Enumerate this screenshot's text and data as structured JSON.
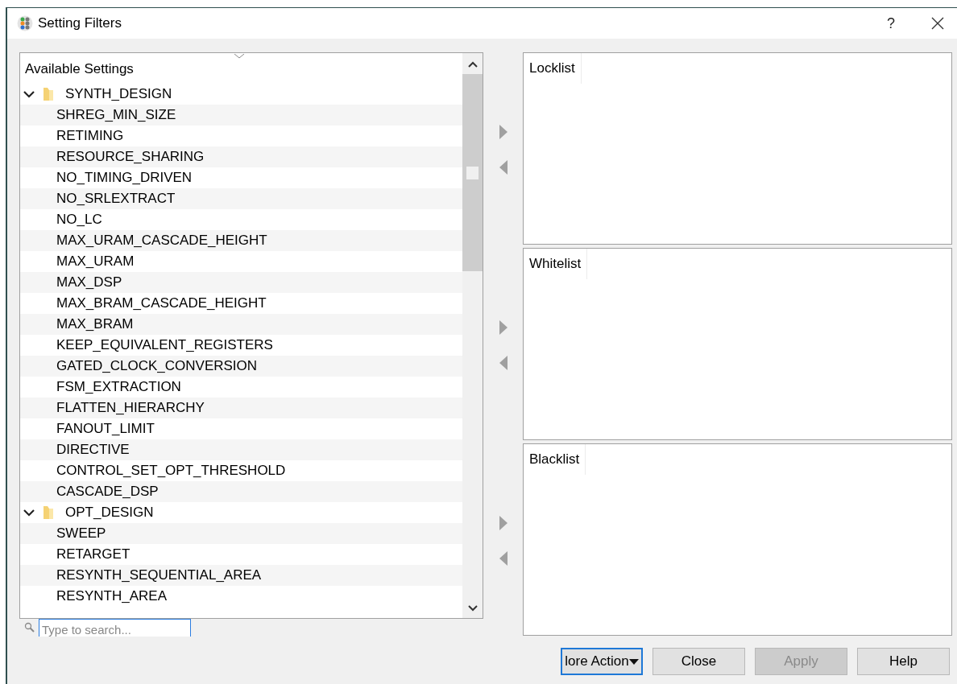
{
  "window": {
    "title": "Setting Filters",
    "help": "?"
  },
  "available": {
    "title": "Available Settings",
    "groups": [
      {
        "label": "SYNTH_DESIGN",
        "expanded": true,
        "children": [
          {
            "label": "SHREG_MIN_SIZE"
          },
          {
            "label": "RETIMING"
          },
          {
            "label": "RESOURCE_SHARING"
          },
          {
            "label": "NO_TIMING_DRIVEN"
          },
          {
            "label": "NO_SRLEXTRACT"
          },
          {
            "label": "NO_LC"
          },
          {
            "label": "MAX_URAM_CASCADE_HEIGHT"
          },
          {
            "label": "MAX_URAM"
          },
          {
            "label": "MAX_DSP"
          },
          {
            "label": "MAX_BRAM_CASCADE_HEIGHT"
          },
          {
            "label": "MAX_BRAM"
          },
          {
            "label": "KEEP_EQUIVALENT_REGISTERS"
          },
          {
            "label": "GATED_CLOCK_CONVERSION"
          },
          {
            "label": "FSM_EXTRACTION"
          },
          {
            "label": "FLATTEN_HIERARCHY"
          },
          {
            "label": "FANOUT_LIMIT"
          },
          {
            "label": "DIRECTIVE"
          },
          {
            "label": "CONTROL_SET_OPT_THRESHOLD"
          },
          {
            "label": "CASCADE_DSP"
          }
        ]
      },
      {
        "label": "OPT_DESIGN",
        "expanded": true,
        "children": [
          {
            "label": "SWEEP"
          },
          {
            "label": "RETARGET"
          },
          {
            "label": "RESYNTH_SEQUENTIAL_AREA"
          },
          {
            "label": "RESYNTH_AREA"
          }
        ]
      }
    ]
  },
  "search": {
    "placeholder": "Type to search..."
  },
  "lists": [
    {
      "title": "Locklist"
    },
    {
      "title": "Whitelist"
    },
    {
      "title": "Blacklist"
    }
  ],
  "buttons": [
    {
      "label": "lore Action",
      "kind": "menu",
      "focused": true,
      "disabled": false
    },
    {
      "label": "Close",
      "kind": "plain",
      "focused": false,
      "disabled": false
    },
    {
      "label": "Apply",
      "kind": "plain",
      "focused": false,
      "disabled": true
    },
    {
      "label": "Help",
      "kind": "plain",
      "focused": false,
      "disabled": false
    }
  ]
}
